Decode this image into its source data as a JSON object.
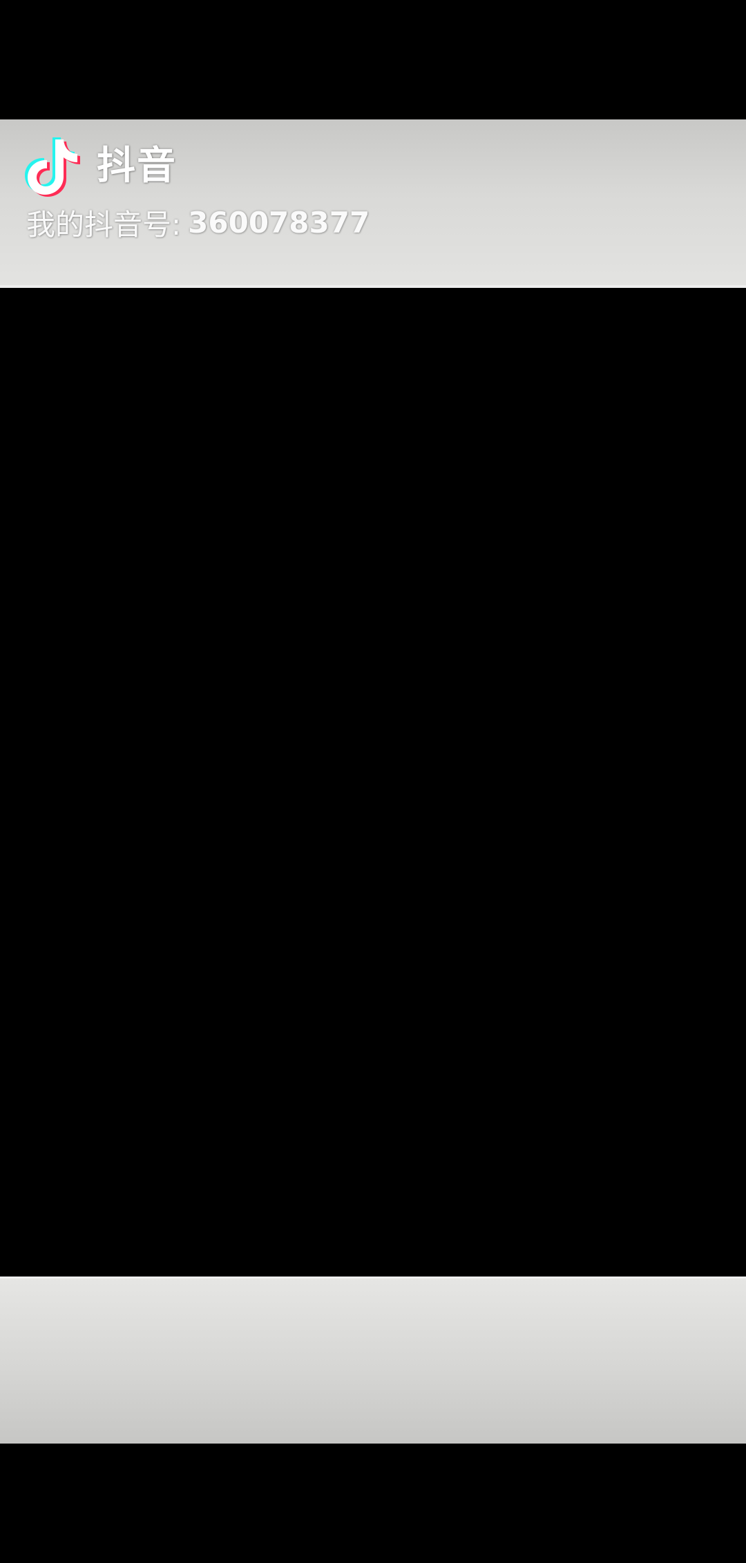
{
  "watermark_top": {
    "app_name": "抖音",
    "account_label": "我的抖音号:",
    "account_id": "360078377",
    "logo_icon": "tiktok-note-icon",
    "colors": {
      "logo_cyan": "#25f4ee",
      "logo_red": "#fe2c55",
      "logo_white": "#ffffff",
      "text": "#fafafa"
    }
  }
}
